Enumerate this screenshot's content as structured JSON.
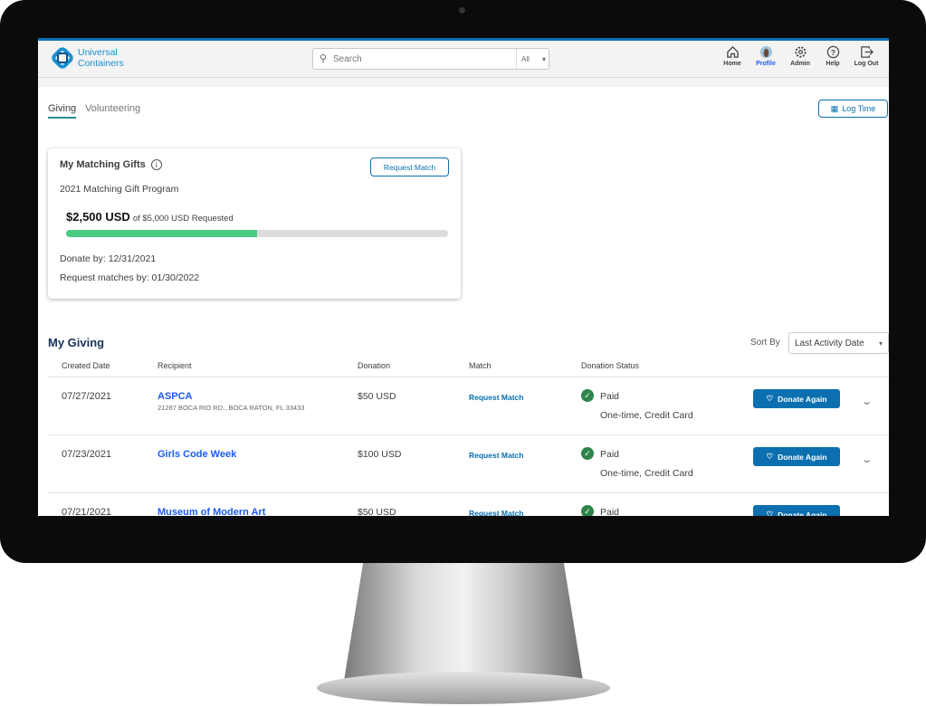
{
  "brand": {
    "line1": "Universal",
    "line2": "Containers"
  },
  "search": {
    "placeholder": "Search",
    "scope": "All"
  },
  "nav": [
    {
      "label": "Home",
      "icon": "home-icon"
    },
    {
      "label": "Profile",
      "icon": "avatar"
    },
    {
      "label": "Admin",
      "icon": "gear-icon"
    },
    {
      "label": "Help",
      "icon": "help-icon"
    },
    {
      "label": "Log Out",
      "icon": "logout-icon"
    }
  ],
  "tabs": [
    {
      "label": "Giving",
      "active": true
    },
    {
      "label": "Volunteering",
      "active": false
    }
  ],
  "log_time": "Log Time",
  "matching": {
    "title": "My Matching Gifts",
    "request_label": "Request Match",
    "program": "2021 Matching Gift Program",
    "amount": "$2,500 USD",
    "of_text": "of $5,000 USD Requested",
    "progress_percent": 50,
    "donate_by": "Donate by: 12/31/2021",
    "request_by": "Request matches by: 01/30/2022"
  },
  "giving": {
    "title": "My Giving",
    "sort_label": "Sort By",
    "sort_value": "Last Activity Date",
    "columns": [
      "Created Date",
      "Recipient",
      "Donation",
      "Match",
      "Donation Status"
    ],
    "rows": [
      {
        "date": "07/27/2021",
        "recipient": "ASPCA",
        "address": "21287 BOCA RIO RD., BOCA RATON, FL 33433",
        "donation": "$50 USD",
        "match": "Request Match",
        "status": "Paid",
        "detail": "One-time, Credit Card",
        "action": "Donate Again"
      },
      {
        "date": "07/23/2021",
        "recipient": "Girls Code Week",
        "address": "",
        "donation": "$100 USD",
        "match": "Request Match",
        "status": "Paid",
        "detail": "One-time, Credit Card",
        "action": "Donate Again"
      },
      {
        "date": "07/21/2021",
        "recipient": "Museum of Modern Art",
        "address": "",
        "donation": "$50 USD",
        "match": "Request Match",
        "status": "Paid",
        "detail": "",
        "action": "Donate Again"
      }
    ]
  },
  "colors": {
    "accent": "#0b6fb0",
    "progress": "#4bca81",
    "paid": "#2e844a",
    "link": "#1b5cf0"
  }
}
